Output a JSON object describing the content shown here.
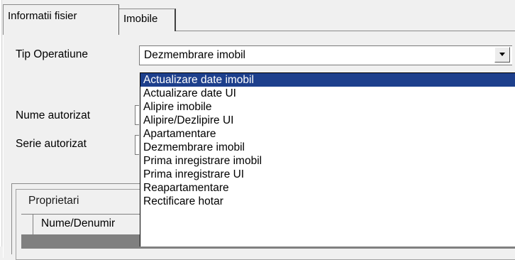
{
  "tabs": [
    {
      "label": "Informatii fisier",
      "active": true
    },
    {
      "label": "Imobile",
      "active": false
    }
  ],
  "form": {
    "tip_operatiune_label": "Tip Operatiune",
    "tip_operatiune_value": "Dezmembrare imobil",
    "nume_autorizat_label": "Nume autorizat",
    "serie_autorizat_label": "Serie autorizat"
  },
  "dropdown": {
    "selected_index": 0,
    "options": [
      "Actualizare date imobil",
      "Actualizare date UI",
      "Alipire imobile",
      "Alipire/Dezlipire UI",
      "Apartamentare",
      "Dezmembrare imobil",
      "Prima inregistrare imobil",
      "Prima inregistrare UI",
      "Reapartamentare",
      "Rectificare hotar"
    ]
  },
  "proprietari": {
    "group_title": "Proprietari",
    "column_header": "Nume/Denumir"
  },
  "icons": {
    "combo_button": "chevron-down-icon"
  },
  "colors": {
    "selection": "#1d3f8c",
    "background": "#f0f0f0"
  }
}
